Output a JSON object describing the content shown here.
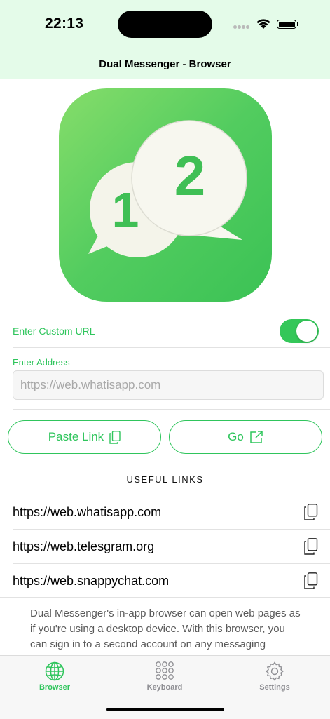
{
  "status_bar": {
    "time": "22:13"
  },
  "nav": {
    "title": "Dual Messenger - Browser"
  },
  "logo": {
    "left_number": "1",
    "right_number": "2"
  },
  "custom_url": {
    "label": "Enter Custom URL",
    "enabled": true
  },
  "address": {
    "label": "Enter Address",
    "placeholder": "https://web.whatisapp.com",
    "value": ""
  },
  "buttons": {
    "paste": "Paste Link",
    "go": "Go"
  },
  "useful_links": {
    "header": "USEFUL LINKS",
    "items": [
      {
        "url": "https://web.whatisapp.com"
      },
      {
        "url": "https://web.telesgram.org"
      },
      {
        "url": "https://web.snappychat.com"
      }
    ]
  },
  "description": "Dual Messenger's in-app browser can open web pages as if you're using a desktop device. With this browser, you can sign in to a second account on any messaging",
  "tabs": [
    {
      "label": "Browser",
      "icon": "globe-icon",
      "active": true
    },
    {
      "label": "Keyboard",
      "icon": "keyboard-grid-icon",
      "active": false
    },
    {
      "label": "Settings",
      "icon": "gear-icon",
      "active": false
    }
  ],
  "colors": {
    "accent": "#2fc55c",
    "toggle_on": "#34c759",
    "header_bg": "#e4fbe9",
    "inactive": "#8e8e93"
  }
}
